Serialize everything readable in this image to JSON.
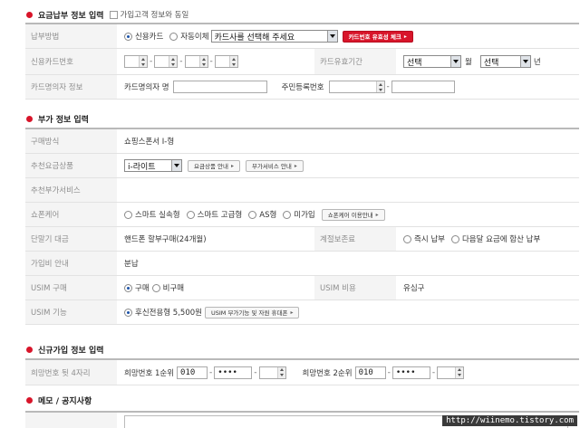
{
  "sec_billing": {
    "title": "요금납부 정보 입력",
    "same_as_subscriber": "가입고객 정보와 동일"
  },
  "billing": {
    "method_label": "납부방법",
    "method_options": [
      "신용카드",
      "자동이체"
    ],
    "card_company_select": "카드사를 선택해 주세요",
    "validity_btn": "카드번호 유효성 체크",
    "card_number_label": "신용카드번호",
    "card_expiry_label": "카드유효기간",
    "expiry_month_select": "선택",
    "month_unit": "월",
    "expiry_year_select": "선택",
    "year_unit": "년",
    "holder_label": "카드명의자 정보",
    "holder_name_label": "카드명의자 명",
    "resident_no_label": "주민등록번호",
    "resident_dash": "-"
  },
  "sec_extra": {
    "title": "부가 정보 입력"
  },
  "extra": {
    "purchase_label": "구매방식",
    "purchase_value": "쇼핑스폰서 I-형",
    "plan_label": "추천요금상품",
    "plan_select": "i-라이트",
    "plan_info_btn": "요금상품 안내",
    "addon_info_btn": "부가서비스 안내",
    "addon_label": "추천부가서비스",
    "showcare_label": "쇼폰케어",
    "showcare_options": [
      "스마트 실속형",
      "스마트 고급형",
      "AS형",
      "미가입"
    ],
    "showcare_btn": "쇼폰케어 이용안내",
    "installment_label": "단말기 대금",
    "installment_value": "핸드폰 할부구매(24개월)",
    "discontinue_label": "계절보존료",
    "discontinue_options": [
      "즉시 납부",
      "다음달 요금에 합산 납부"
    ],
    "join_guide_label": "가입비 안내",
    "join_guide_value": "분납",
    "usim_buy_label": "USIM 구매",
    "usim_buy_options": [
      "구매",
      "비구매"
    ],
    "usim_fee_label": "USIM 비용",
    "usim_fee_value": "유심구",
    "usim_func_label": "USIM 기능",
    "usim_func_option": "후신전용형 5,500원",
    "usim_func_btn": "USIM 부가기능 및 자원 휴대폰"
  },
  "sec_newline": {
    "title": "신규가입 정보 입력"
  },
  "newline": {
    "wish_label": "희망번호 뒷 4자리",
    "first_label": "희망번호 1순위",
    "second_label": "희망번호 2순위",
    "prefix1": "010",
    "mask1": "••••",
    "prefix2": "010",
    "mask2": "••••",
    "dash": "-"
  },
  "sec_memo": {
    "title": "메모 / 공지사항"
  },
  "watermark": "http://wiinemo.tistory.com",
  "colors": {
    "accent": "#d8152a",
    "label_bg": "#f4f4f4",
    "label_text": "#8e8e8e"
  }
}
